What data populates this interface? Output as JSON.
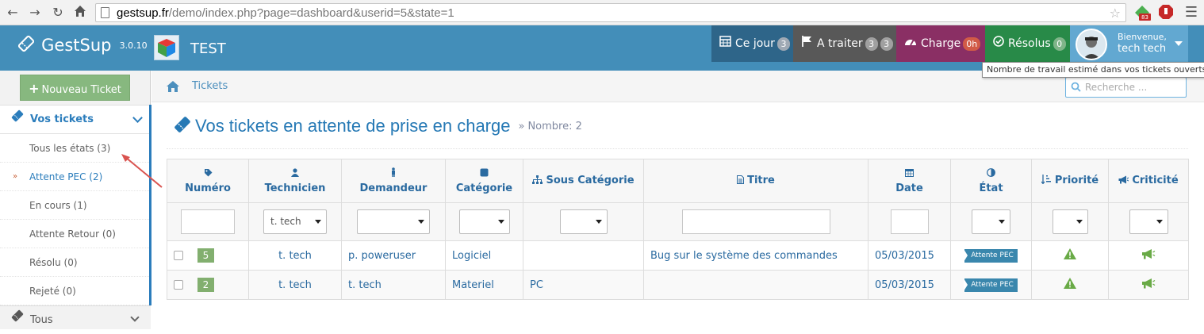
{
  "browser": {
    "url_host": "gestsup.fr",
    "url_path": "/demo/index.php?page=dashboard&userid=5&state=1",
    "ext_badge": "83"
  },
  "brand": {
    "name": "GestSup",
    "version": "3.0.10",
    "company": "TEST"
  },
  "top_tabs": {
    "today": {
      "label": "Ce jour",
      "badge": "3"
    },
    "todo": {
      "label": "A traiter",
      "badge1": "3",
      "badge2": "3"
    },
    "load": {
      "label": "Charge",
      "badge": "0h"
    },
    "solved": {
      "label": "Résolus",
      "badge": "0"
    },
    "user": {
      "welcome": "Bienvenue,",
      "name": "tech tech"
    }
  },
  "tooltip": "Nombre de travail estimé dans vos tickets ouverts",
  "sidebar": {
    "new_ticket": "Nouveau Ticket",
    "section_mine": "Vos tickets",
    "items": [
      {
        "label": "Tous les états (3)"
      },
      {
        "label": "Attente PEC (2)"
      },
      {
        "label": "En cours (1)"
      },
      {
        "label": "Attente Retour (0)"
      },
      {
        "label": "Résolu (0)"
      },
      {
        "label": "Rejeté (0)"
      }
    ],
    "section_all": "Tous"
  },
  "breadcrumb": {
    "link": "Tickets"
  },
  "search": {
    "placeholder": "Recherche ..."
  },
  "page": {
    "title": "Vos tickets en attente de prise en charge",
    "separator": "»",
    "count": "Nombre: 2"
  },
  "table": {
    "headers": {
      "numero": "Numéro",
      "technicien": "Technicien",
      "demandeur": "Demandeur",
      "categorie": "Catégorie",
      "sous_categorie": "Sous Catégorie",
      "titre": "Titre",
      "date": "Date",
      "etat": "État",
      "priorite": "Priorité",
      "criticite": "Criticité"
    },
    "filters": {
      "technicien": "t. tech"
    },
    "rows": [
      {
        "num": "5",
        "tech": "t. tech",
        "requester": "p. poweruser",
        "category": "Logiciel",
        "subcategory": "",
        "title": "Bug sur le système des commandes",
        "date": "05/03/2015",
        "state": "Attente PEC"
      },
      {
        "num": "2",
        "tech": "t. tech",
        "requester": "t. tech",
        "category": "Materiel",
        "subcategory": "PC",
        "title": "",
        "date": "05/03/2015",
        "state": "Attente PEC"
      }
    ]
  },
  "colors": {
    "navbar": "#438eb9",
    "accent": "#2679b5",
    "today": "#2e6589",
    "todo": "#585858",
    "load": "#8a2f64",
    "solved": "#288a48",
    "user": "#62a8d1",
    "success_badge": "#82af6f",
    "warning": "#c86139"
  }
}
